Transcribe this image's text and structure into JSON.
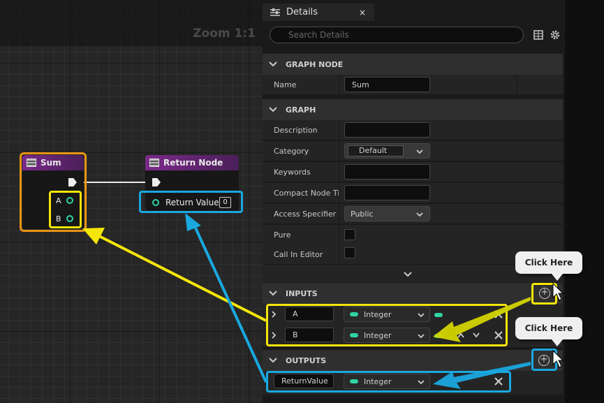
{
  "graph": {
    "zoom_label": "Zoom 1:1",
    "sum_node": {
      "title": "Sum",
      "pins": [
        "A",
        "B"
      ]
    },
    "return_node": {
      "title": "Return Node",
      "pin_label": "Return Value",
      "pin_value": "0"
    }
  },
  "details": {
    "tab_label": "Details",
    "close": "×",
    "search_placeholder": "Search Details",
    "sections": {
      "graph_node": "GRAPH NODE",
      "graph": "GRAPH",
      "inputs": "INPUTS",
      "outputs": "OUTPUTS"
    },
    "name": {
      "label": "Name",
      "value": "Sum"
    },
    "description": {
      "label": "Description",
      "value": ""
    },
    "category": {
      "label": "Category",
      "value": "Default"
    },
    "keywords": {
      "label": "Keywords",
      "value": ""
    },
    "compact_title": {
      "label": "Compact Node Ti",
      "value": ""
    },
    "access": {
      "label": "Access Specifier",
      "value": "Public"
    },
    "pure": {
      "label": "Pure"
    },
    "call_in_editor": {
      "label": "Call In Editor"
    },
    "inputs": [
      {
        "name": "A",
        "type": "Integer"
      },
      {
        "name": "B",
        "type": "Integer"
      }
    ],
    "outputs": [
      {
        "name": "ReturnValue",
        "type": "Integer"
      }
    ]
  },
  "callouts": {
    "top": "Click Here",
    "bottom": "Click Here"
  },
  "colors": {
    "highlight_yellow": "#f5e60a",
    "highlight_blue": "#1aa8e0",
    "highlight_orange": "#e89515",
    "node_header": "#7b2a8a",
    "pin_teal": "#2fd3a4"
  },
  "icons": [
    "details-icon",
    "search-icon",
    "table-view-icon",
    "gear-icon",
    "chevron-down-icon",
    "chevron-right-icon",
    "close-icon",
    "add-icon",
    "cursor-icon",
    "arrow-up-icon",
    "arrow-down-icon"
  ]
}
